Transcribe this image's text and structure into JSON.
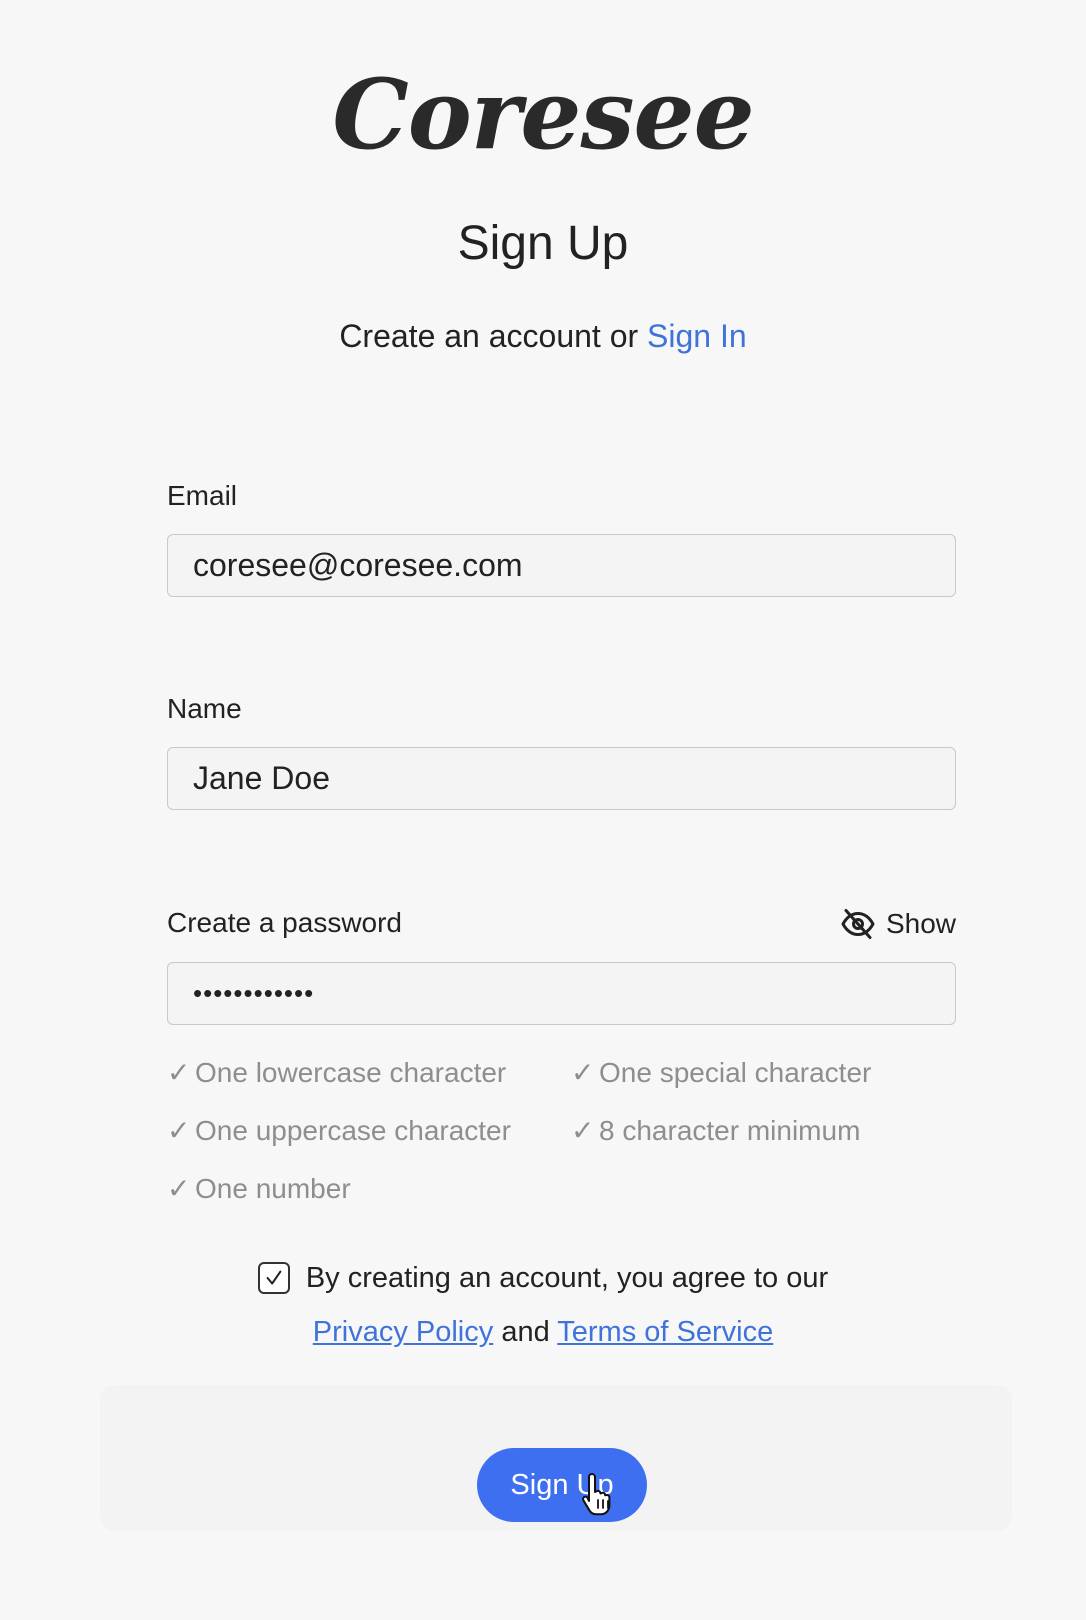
{
  "brand": {
    "logo_text": "Coresee"
  },
  "header": {
    "title": "Sign Up",
    "subtitle_prefix": "Create an account or ",
    "signin_link": "Sign In"
  },
  "form": {
    "email": {
      "label": "Email",
      "value": "coresee@coresee.com"
    },
    "name": {
      "label": "Name",
      "value": "Jane Doe"
    },
    "password": {
      "label": "Create a password",
      "value": "••••••••••••",
      "toggle_label": "Show",
      "toggle_icon": "eye-off-icon"
    },
    "requirements": [
      {
        "check": "✓",
        "text": "One lowercase character"
      },
      {
        "check": "✓",
        "text": "One special character"
      },
      {
        "check": "✓",
        "text": "One uppercase character"
      },
      {
        "check": "✓",
        "text": "8 character minimum"
      },
      {
        "check": "✓",
        "text": "One number"
      }
    ],
    "agreement": {
      "checked": true,
      "text": "By creating an account, you agree to our",
      "privacy_link": "Privacy Policy",
      "and_text": "and",
      "terms_link": "Terms of Service"
    },
    "submit_label": "Sign Up"
  },
  "colors": {
    "accent": "#3e6ff0",
    "link": "#3f73db",
    "background": "#f7f7f7",
    "requirement_text": "#8e8e8e"
  }
}
